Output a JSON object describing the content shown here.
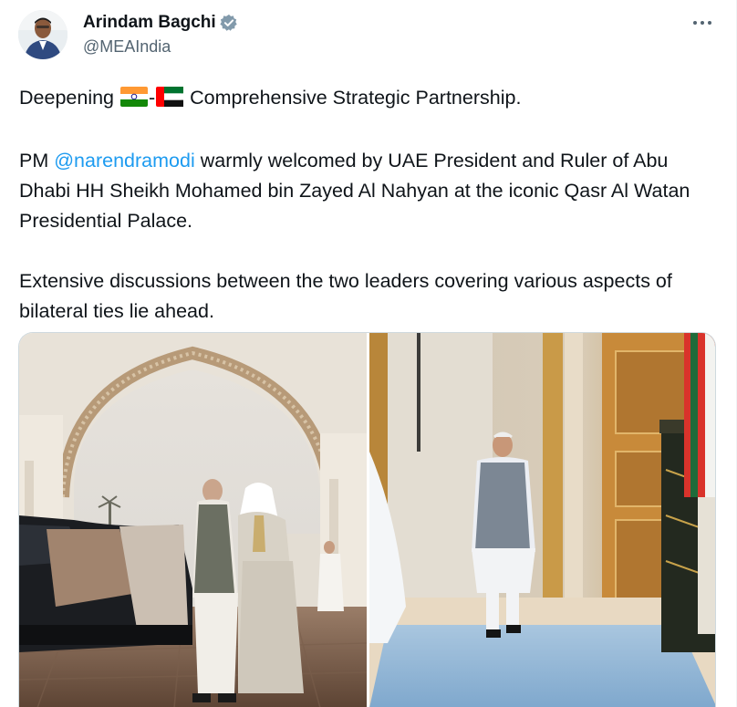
{
  "author": {
    "name": "Arindam Bagchi",
    "handle": "@MEAIndia",
    "avatar_icon": "person-avatar",
    "verified_icon": "verified-badge-icon"
  },
  "menu": {
    "icon": "more-options-icon"
  },
  "tweet": {
    "line1_before": "Deepening ",
    "line1_separator": "-",
    "line1_after": " Comprehensive Strategic Partnership.",
    "flag1": "india-flag-emoji",
    "flag2": "uae-flag-emoji",
    "para2_prefix": "PM ",
    "mention": "@narendramodi",
    "para2_rest": " warmly welcomed by UAE President and Ruler of Abu Dhabi HH Sheikh Mohamed bin Zayed Al Nahyan at the iconic Qasr Al Watan Presidential Palace.",
    "para3": "Extensive discussions between the two leaders covering various aspects of bilateral ties lie ahead."
  },
  "media": {
    "photos": [
      {
        "name": "photo-palace-arch-greeting"
      },
      {
        "name": "photo-guard-of-honour-walk"
      }
    ]
  },
  "colors": {
    "link": "#1d9bf0",
    "secondary": "#536471",
    "verified": "#829aab",
    "text": "#0f1419"
  }
}
